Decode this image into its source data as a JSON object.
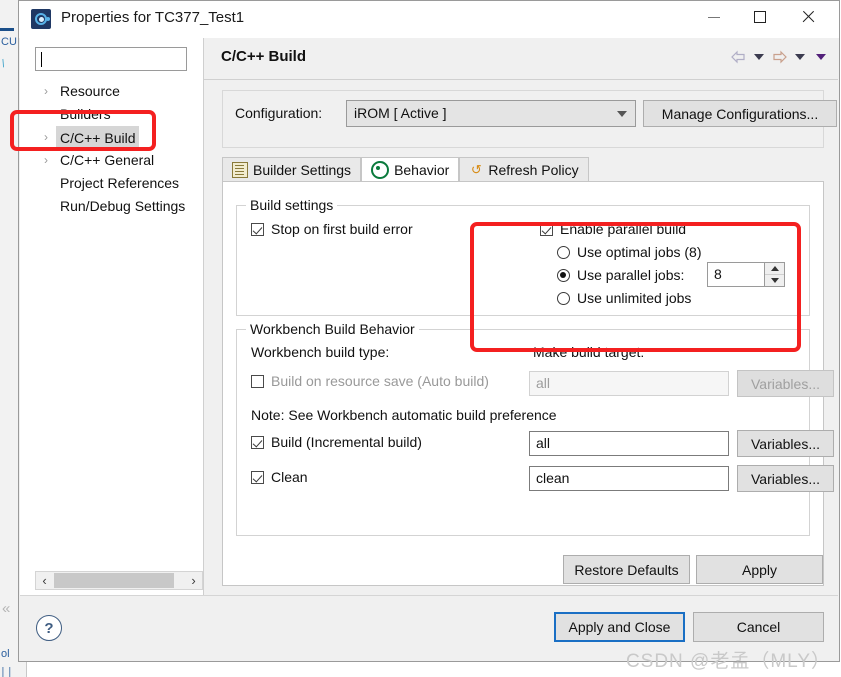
{
  "window": {
    "title": "Properties for TC377_Test1",
    "icon": "eclipse-properties-icon",
    "minimize": "—",
    "maximize": "□",
    "close": "✕"
  },
  "sidebar": {
    "filter": {
      "value": "",
      "placeholder": ""
    },
    "items": [
      {
        "label": "Resource",
        "expandable": true,
        "selected": false
      },
      {
        "label": "Builders",
        "expandable": false,
        "selected": false
      },
      {
        "label": "C/C++ Build",
        "expandable": true,
        "selected": true
      },
      {
        "label": "C/C++ General",
        "expandable": true,
        "selected": false
      },
      {
        "label": "Project References",
        "expandable": false,
        "selected": false
      },
      {
        "label": "Run/Debug Settings",
        "expandable": false,
        "selected": false
      }
    ],
    "twisty": "›",
    "scroll_left": "‹",
    "scroll_right": "›"
  },
  "header": {
    "page_title": "C/C++ Build",
    "nav": {
      "back": "back-arrow-icon",
      "back_menu": "chevron-down-icon",
      "forward": "forward-arrow-icon",
      "forward_menu": "chevron-down-icon",
      "more": "chevron-down-icon"
    }
  },
  "configuration": {
    "label": "Configuration:",
    "value": "iROM  [ Active ]",
    "manage_button": "Manage Configurations..."
  },
  "tabs": [
    {
      "label": "Builder Settings",
      "icon": "list-icon",
      "active": false
    },
    {
      "label": "Behavior",
      "icon": "target-icon",
      "active": true
    },
    {
      "label": "Refresh Policy",
      "icon": "refresh-icon",
      "active": false
    }
  ],
  "build_settings": {
    "legend": "Build settings",
    "stop_on_first_error": {
      "label": "Stop on first build error",
      "checked": true
    },
    "enable_parallel_build": {
      "label": "Enable parallel build",
      "checked": true
    },
    "radios": [
      {
        "label": "Use optimal jobs (8)",
        "selected": false
      },
      {
        "label": "Use parallel jobs:",
        "selected": true
      },
      {
        "label": "Use unlimited jobs",
        "selected": false
      }
    ],
    "jobs_spinner": {
      "value": "8",
      "up": "▲",
      "down": "▼"
    }
  },
  "workbench": {
    "legend": "Workbench Build Behavior",
    "build_type_label": "Workbench build type:",
    "make_target_label": "Make build target:",
    "note": "Note: See Workbench automatic build preference",
    "rows": [
      {
        "label": "Build on resource save (Auto build)",
        "checked": false,
        "target": "all",
        "button": "Variables...",
        "enabled": false
      },
      {
        "label": "Build (Incremental build)",
        "checked": true,
        "target": "all",
        "button": "Variables...",
        "enabled": true
      },
      {
        "label": "Clean",
        "checked": true,
        "target": "clean",
        "button": "Variables...",
        "enabled": true
      }
    ]
  },
  "actions": {
    "restore_defaults": "Restore Defaults",
    "apply": "Apply",
    "apply_and_close": "Apply and Close",
    "cancel": "Cancel",
    "help": "?"
  },
  "annotations": {
    "color": "#f42020",
    "boxes": [
      "sidebar-ccpp-build",
      "parallel-build-options"
    ]
  },
  "watermark": "CSDN @老孟（MLY）"
}
